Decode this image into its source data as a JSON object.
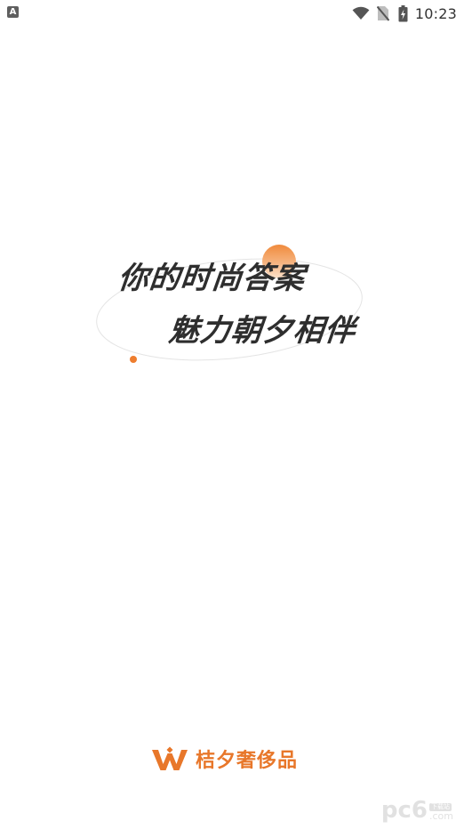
{
  "status_bar": {
    "app_icon_letter": "A",
    "time": "10:23",
    "icons": [
      "wifi-icon",
      "no-sim-icon",
      "battery-charging-icon"
    ]
  },
  "splash": {
    "slogan_line_1": "你的时尚答案",
    "slogan_line_2": "魅力朝夕相伴",
    "accent_color": "#f0883a",
    "text_color": "#2e2e2e"
  },
  "brand": {
    "logo_icon": "brand-w-logo-icon",
    "name": "桔夕奢侈品",
    "color": "#e8772a"
  },
  "watermark": {
    "main": "pc6",
    "badge": "下载站",
    "domain": ".com"
  }
}
